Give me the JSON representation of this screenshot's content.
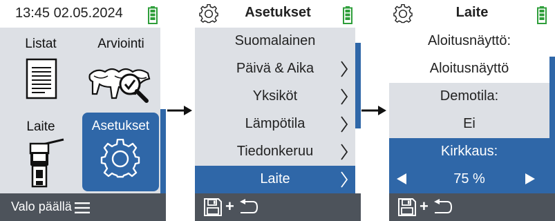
{
  "screen1": {
    "clock": "13:45 02.05.2024",
    "tiles": {
      "lists": "Listat",
      "rating": "Arviointi",
      "device": "Laite",
      "settings": "Asetukset"
    },
    "footer_text": "Valo päällä",
    "icons": [
      "battery-icon",
      "document-icon",
      "cow-check-icon",
      "probe-device-icon",
      "gear-icon",
      "menu-icon"
    ]
  },
  "screen2": {
    "title": "Asetukset",
    "items": [
      {
        "label": "Suomalainen",
        "chevron": false
      },
      {
        "label": "Päivä & Aika",
        "chevron": true
      },
      {
        "label": "Yksiköt",
        "chevron": true
      },
      {
        "label": "Lämpötila",
        "chevron": true
      },
      {
        "label": "Tiedonkeruu",
        "chevron": true
      },
      {
        "label": "Laite",
        "chevron": true,
        "selected": true
      }
    ],
    "icons": [
      "gear-icon",
      "battery-icon",
      "save-icon",
      "back-icon"
    ]
  },
  "screen3": {
    "title": "Laite",
    "rows": {
      "start_label": "Aloitusnäyttö:",
      "start_value": "Aloitusnäyttö",
      "demo_label": "Demotila:",
      "demo_value": "Ei",
      "brightness_label": "Kirkkaus:",
      "brightness_value": "75 %"
    },
    "icons": [
      "gear-icon",
      "battery-icon",
      "left-arrow-icon",
      "right-arrow-icon",
      "save-icon",
      "back-icon"
    ]
  },
  "colors": {
    "accent": "#2f67a8",
    "panel": "#dde0e5",
    "footer": "#4d535b",
    "battery": "#2e9e3a"
  }
}
